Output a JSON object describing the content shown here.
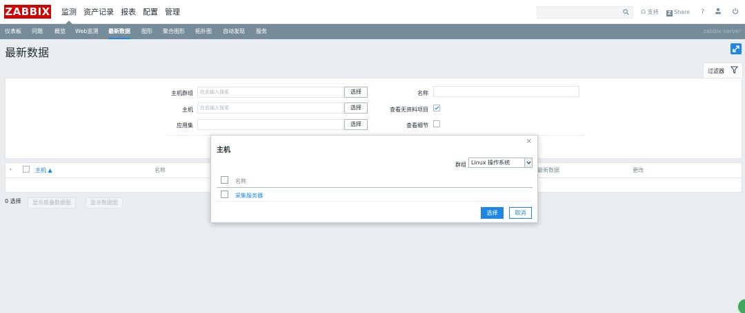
{
  "header": {
    "logo": "ZABBIX",
    "nav": [
      "监测",
      "资产记录",
      "报表",
      "配置",
      "管理"
    ],
    "support": "支持",
    "share": "Share",
    "help": "?"
  },
  "subnav": {
    "items": [
      "仪表板",
      "问题",
      "概览",
      "Web监测",
      "最新数据",
      "图形",
      "聚合图形",
      "拓扑图",
      "自动发现",
      "服务"
    ],
    "server": "zabbix-server"
  },
  "page": {
    "title": "最新数据"
  },
  "filter": {
    "tab_label": "过滤器",
    "host_group_label": "主机群组",
    "host_group_placeholder": "在此输入搜索",
    "host_label": "主机",
    "host_placeholder": "在此输入搜索",
    "app_label": "应用集",
    "select_label": "选择",
    "name_label": "名称",
    "show_without_data_label": "查看无资料项目",
    "show_without_data_checked": true,
    "show_details_label": "查看细节"
  },
  "table": {
    "columns": [
      "主机 ▲",
      "名称",
      "最新数据",
      "更改"
    ]
  },
  "footer": {
    "selected": "0 选择",
    "btn_stacked": "显示堆叠数据图",
    "btn_graph": "显示数据图"
  },
  "modal": {
    "title": "主机",
    "close": "×",
    "group_label": "群组",
    "group_value": "Linux 操作系统",
    "column_name": "名称",
    "rows": [
      "采集服务器"
    ],
    "select_btn": "选择",
    "cancel_btn": "取消"
  },
  "colors": {
    "brand": "#d40000",
    "accent": "#1e87e3",
    "subnav": "#768d99"
  }
}
